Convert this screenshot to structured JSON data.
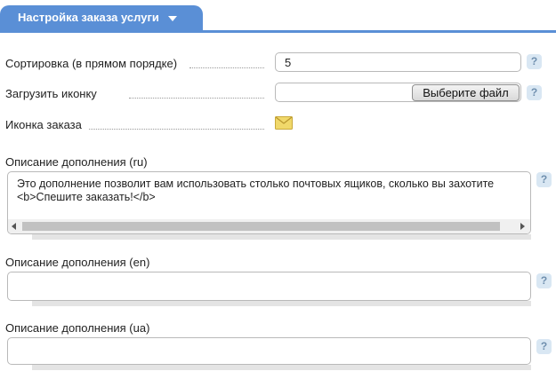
{
  "tab": {
    "title": "Настройка заказа услуги"
  },
  "form": {
    "sort_label": "Сортировка (в прямом порядке)",
    "sort_value": "5",
    "upload_icon_label": "Загрузить иконку",
    "choose_file_label": "Выберите файл",
    "order_icon_label": "Иконка заказа",
    "help_symbol": "?"
  },
  "descriptions": [
    {
      "label": "Описание дополнения (ru)",
      "value": "Это дополнение позволит вам использовать столько почтовых ящиков, сколько вы захотите\n<b>Спешите заказать!</b>"
    },
    {
      "label": "Описание дополнения (en)",
      "value": ""
    },
    {
      "label": "Описание дополнения (ua)",
      "value": ""
    }
  ],
  "colors": {
    "accent": "#5a8fd6",
    "help_bg": "#d9e7f3",
    "envelope": "#f0d86a"
  }
}
